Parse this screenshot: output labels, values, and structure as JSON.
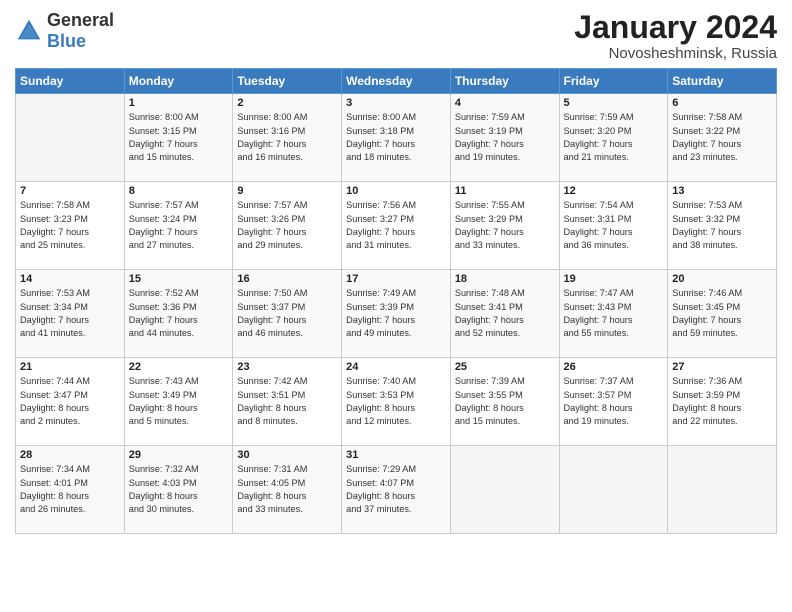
{
  "logo": {
    "general": "General",
    "blue": "Blue"
  },
  "header": {
    "month": "January 2024",
    "location": "Novosheshminsk, Russia"
  },
  "days_of_week": [
    "Sunday",
    "Monday",
    "Tuesday",
    "Wednesday",
    "Thursday",
    "Friday",
    "Saturday"
  ],
  "weeks": [
    [
      {
        "day": "",
        "info": ""
      },
      {
        "day": "1",
        "info": "Sunrise: 8:00 AM\nSunset: 3:15 PM\nDaylight: 7 hours\nand 15 minutes."
      },
      {
        "day": "2",
        "info": "Sunrise: 8:00 AM\nSunset: 3:16 PM\nDaylight: 7 hours\nand 16 minutes."
      },
      {
        "day": "3",
        "info": "Sunrise: 8:00 AM\nSunset: 3:18 PM\nDaylight: 7 hours\nand 18 minutes."
      },
      {
        "day": "4",
        "info": "Sunrise: 7:59 AM\nSunset: 3:19 PM\nDaylight: 7 hours\nand 19 minutes."
      },
      {
        "day": "5",
        "info": "Sunrise: 7:59 AM\nSunset: 3:20 PM\nDaylight: 7 hours\nand 21 minutes."
      },
      {
        "day": "6",
        "info": "Sunrise: 7:58 AM\nSunset: 3:22 PM\nDaylight: 7 hours\nand 23 minutes."
      }
    ],
    [
      {
        "day": "7",
        "info": "Sunrise: 7:58 AM\nSunset: 3:23 PM\nDaylight: 7 hours\nand 25 minutes."
      },
      {
        "day": "8",
        "info": "Sunrise: 7:57 AM\nSunset: 3:24 PM\nDaylight: 7 hours\nand 27 minutes."
      },
      {
        "day": "9",
        "info": "Sunrise: 7:57 AM\nSunset: 3:26 PM\nDaylight: 7 hours\nand 29 minutes."
      },
      {
        "day": "10",
        "info": "Sunrise: 7:56 AM\nSunset: 3:27 PM\nDaylight: 7 hours\nand 31 minutes."
      },
      {
        "day": "11",
        "info": "Sunrise: 7:55 AM\nSunset: 3:29 PM\nDaylight: 7 hours\nand 33 minutes."
      },
      {
        "day": "12",
        "info": "Sunrise: 7:54 AM\nSunset: 3:31 PM\nDaylight: 7 hours\nand 36 minutes."
      },
      {
        "day": "13",
        "info": "Sunrise: 7:53 AM\nSunset: 3:32 PM\nDaylight: 7 hours\nand 38 minutes."
      }
    ],
    [
      {
        "day": "14",
        "info": "Sunrise: 7:53 AM\nSunset: 3:34 PM\nDaylight: 7 hours\nand 41 minutes."
      },
      {
        "day": "15",
        "info": "Sunrise: 7:52 AM\nSunset: 3:36 PM\nDaylight: 7 hours\nand 44 minutes."
      },
      {
        "day": "16",
        "info": "Sunrise: 7:50 AM\nSunset: 3:37 PM\nDaylight: 7 hours\nand 46 minutes."
      },
      {
        "day": "17",
        "info": "Sunrise: 7:49 AM\nSunset: 3:39 PM\nDaylight: 7 hours\nand 49 minutes."
      },
      {
        "day": "18",
        "info": "Sunrise: 7:48 AM\nSunset: 3:41 PM\nDaylight: 7 hours\nand 52 minutes."
      },
      {
        "day": "19",
        "info": "Sunrise: 7:47 AM\nSunset: 3:43 PM\nDaylight: 7 hours\nand 55 minutes."
      },
      {
        "day": "20",
        "info": "Sunrise: 7:46 AM\nSunset: 3:45 PM\nDaylight: 7 hours\nand 59 minutes."
      }
    ],
    [
      {
        "day": "21",
        "info": "Sunrise: 7:44 AM\nSunset: 3:47 PM\nDaylight: 8 hours\nand 2 minutes."
      },
      {
        "day": "22",
        "info": "Sunrise: 7:43 AM\nSunset: 3:49 PM\nDaylight: 8 hours\nand 5 minutes."
      },
      {
        "day": "23",
        "info": "Sunrise: 7:42 AM\nSunset: 3:51 PM\nDaylight: 8 hours\nand 8 minutes."
      },
      {
        "day": "24",
        "info": "Sunrise: 7:40 AM\nSunset: 3:53 PM\nDaylight: 8 hours\nand 12 minutes."
      },
      {
        "day": "25",
        "info": "Sunrise: 7:39 AM\nSunset: 3:55 PM\nDaylight: 8 hours\nand 15 minutes."
      },
      {
        "day": "26",
        "info": "Sunrise: 7:37 AM\nSunset: 3:57 PM\nDaylight: 8 hours\nand 19 minutes."
      },
      {
        "day": "27",
        "info": "Sunrise: 7:36 AM\nSunset: 3:59 PM\nDaylight: 8 hours\nand 22 minutes."
      }
    ],
    [
      {
        "day": "28",
        "info": "Sunrise: 7:34 AM\nSunset: 4:01 PM\nDaylight: 8 hours\nand 26 minutes."
      },
      {
        "day": "29",
        "info": "Sunrise: 7:32 AM\nSunset: 4:03 PM\nDaylight: 8 hours\nand 30 minutes."
      },
      {
        "day": "30",
        "info": "Sunrise: 7:31 AM\nSunset: 4:05 PM\nDaylight: 8 hours\nand 33 minutes."
      },
      {
        "day": "31",
        "info": "Sunrise: 7:29 AM\nSunset: 4:07 PM\nDaylight: 8 hours\nand 37 minutes."
      },
      {
        "day": "",
        "info": ""
      },
      {
        "day": "",
        "info": ""
      },
      {
        "day": "",
        "info": ""
      }
    ]
  ]
}
